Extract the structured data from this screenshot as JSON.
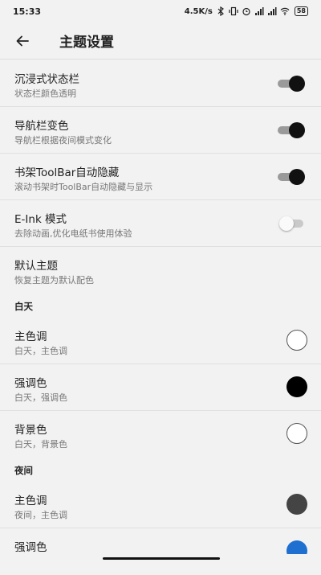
{
  "status": {
    "time": "15:33",
    "speed": "4.5K/s",
    "battery": "58"
  },
  "appbar": {
    "title": "主题设置"
  },
  "settings": [
    {
      "title": "沉浸式状态栏",
      "subtitle": "状态栏颜色透明",
      "toggle": "on"
    },
    {
      "title": "导航栏变色",
      "subtitle": "导航栏根据夜间模式变化",
      "toggle": "on"
    },
    {
      "title": "书架ToolBar自动隐藏",
      "subtitle": "滚动书架时ToolBar自动隐藏与显示",
      "toggle": "on"
    },
    {
      "title": "E-Ink 模式",
      "subtitle": "去除动画,优化电纸书使用体验",
      "toggle": "off"
    },
    {
      "title": "默认主题",
      "subtitle": "恢复主题为默认配色"
    }
  ],
  "day": {
    "header": "白天",
    "items": [
      {
        "title": "主色调",
        "subtitle": "白天，主色调",
        "color": "#ffffff"
      },
      {
        "title": "强调色",
        "subtitle": "白天，强调色",
        "color": "#000000"
      },
      {
        "title": "背景色",
        "subtitle": "白天，背景色",
        "color": "#ffffff"
      }
    ]
  },
  "night": {
    "header": "夜间",
    "items": [
      {
        "title": "主色调",
        "subtitle": "夜间，主色调",
        "color": "#444444"
      },
      {
        "title": "强调色",
        "subtitle": "",
        "color": "#1e6fd0"
      }
    ]
  }
}
